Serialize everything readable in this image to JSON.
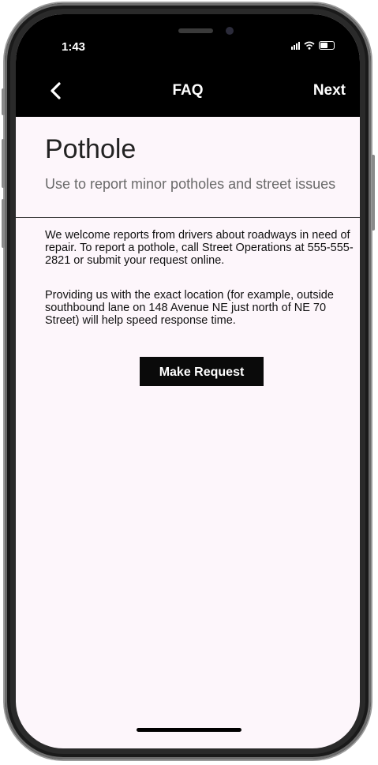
{
  "status_bar": {
    "time": "1:43"
  },
  "nav": {
    "back_icon": "chevron-left-icon",
    "title": "FAQ",
    "next_label": "Next"
  },
  "page": {
    "title": "Pothole",
    "subtitle": "Use to report minor potholes and street issues",
    "paragraphs": [
      "We welcome reports from drivers about roadways in need of repair. To report a pothole, call Street Operations at 555-555-2821 or submit your request online.",
      "Providing us with the exact location (for example, outside southbound lane on 148 Avenue NE just north of NE 70 Street) will help speed response time."
    ],
    "make_request_label": "Make Request"
  },
  "colors": {
    "header": "#000000",
    "content_bg": "#fdf6fb",
    "button": "#0a0a0a"
  }
}
